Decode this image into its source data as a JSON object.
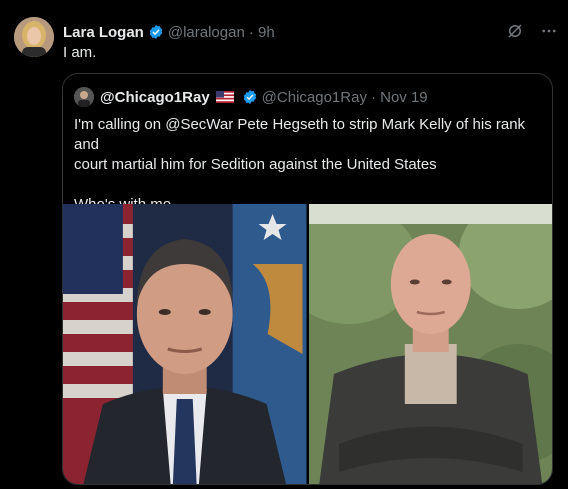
{
  "tweet": {
    "name": "Lara Logan",
    "handle": "@laralogan",
    "time": "· 9h",
    "text": "I am."
  },
  "quote": {
    "name": "@Chicago1Ray",
    "handle": "@Chicago1Ray",
    "time": "· Nov 19",
    "line1": "I'm calling on @SecWar Pete Hegseth to strip Mark Kelly of his rank and",
    "line2": "court martial him for Sedition against the United States",
    "line3": "Who's with me"
  },
  "icons": {
    "verified": "verified-badge-icon",
    "grok": "grok-icon",
    "more": "more-icon",
    "flag": "us-flag-icon"
  },
  "colors": {
    "background": "#000000",
    "text": "#e7e9ea",
    "muted": "#71767b",
    "verified": "#1d9bf0",
    "border": "#2f3336"
  }
}
